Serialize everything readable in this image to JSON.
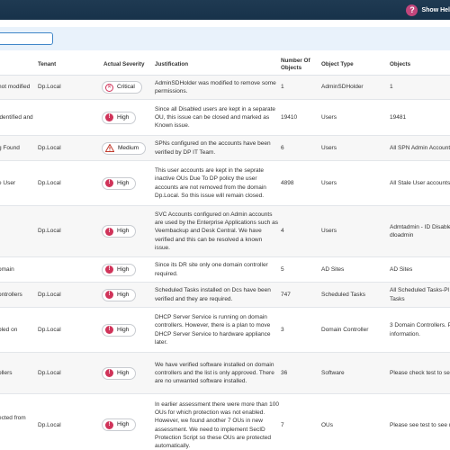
{
  "header": {
    "help_label": "Show Hel",
    "help_icon": "question-circle-icon",
    "accent": "#c2467c"
  },
  "filter": {
    "search_value": ""
  },
  "columns": {
    "name": "",
    "tenant": "Tenant",
    "severity": "Actual Severity",
    "justification": "Justification",
    "number_of_objects_1": "Number Of",
    "number_of_objects_2": "Objects",
    "object_type": "Object Type",
    "objects": "Objects"
  },
  "severity_colors": {
    "critical": "#d0345a",
    "high": "#d0345a",
    "medium": "#c0392b"
  },
  "rows": [
    {
      "name": "not modified",
      "tenant": "Dp.Local",
      "severity": "Critical",
      "justification": "AdminSDHolder was modified to remove some permissions.",
      "count": "1",
      "type": "AdminSDHolder",
      "objects": "1"
    },
    {
      "name": "identified and",
      "tenant": "",
      "severity": "High",
      "justification": "Since all Disabled users are kept in a separate OU, this issue can be closed and marked as Known issue.",
      "count": "19410",
      "type": "Users",
      "objects": "19481"
    },
    {
      "name": "g Found",
      "tenant": "Dp.Local",
      "severity": "Medium",
      "justification": "SPNs configured on the accounts have been verified by DP IT Team.",
      "count": "6",
      "type": "Users",
      "objects": "All SPN Admin Accounts"
    },
    {
      "name": "e User",
      "tenant": "Dp.Local",
      "severity": "High",
      "justification": "This user accounts are kept in the seprate inactive OUs Due To DP policy the user accounts are not removed from the domain Dp.Local. So this issue will remain closed.",
      "count": "4898",
      "type": "Users",
      "objects": "All Stale User accounts"
    },
    {
      "name": "",
      "tenant": "Dp.Local",
      "severity": "High",
      "justification": "SVC Accounts configured on Admin accounts are used by the Enterprise Applications such as Veembackup and Desk Central. We have verified and this can be resolved a known issue.",
      "count": "4",
      "type": "Users",
      "objects": "Admtadmin - ID Disable dloadmin"
    },
    {
      "name": "omain",
      "tenant": "",
      "severity": "High",
      "justification": "Since its DR site only one domain controller required.",
      "count": "5",
      "type": "AD Sites",
      "objects": "AD Sites"
    },
    {
      "name": "ontrollers",
      "tenant": "Dp.Local",
      "severity": "High",
      "justification": "Scheduled Tasks installed on Dcs have been verified and they are required.",
      "count": "747",
      "type": "Scheduled Tasks",
      "objects": "All Scheduled Tasks-Pl Tasks"
    },
    {
      "name": "bled on",
      "tenant": "Dp.Local",
      "severity": "High",
      "justification": "DHCP Server Service is running on domain controllers. However, there is a plan to move DHCP Server Service to hardware appliance later.",
      "count": "3",
      "type": "Domain Controller",
      "objects": "3 Domain Controllers. P information."
    },
    {
      "name": "ollers",
      "tenant": "Dp.Local",
      "severity": "High",
      "justification": "We have verified software installed on domain controllers and the list is only approved. There are no unwanted software installed.",
      "count": "36",
      "type": "Software",
      "objects": "Please check test to se"
    },
    {
      "name": "ected from",
      "tenant": "Dp.Local",
      "severity": "High",
      "justification": "In earlier assessment there were more than 100 OUs for which protection was not enabled. However, we found another 7 OUs in new assessment. We need to implement SecID Protection Script so these OUs are protected automatically.",
      "count": "7",
      "type": "OUs",
      "objects": "Please see test to see u"
    }
  ]
}
